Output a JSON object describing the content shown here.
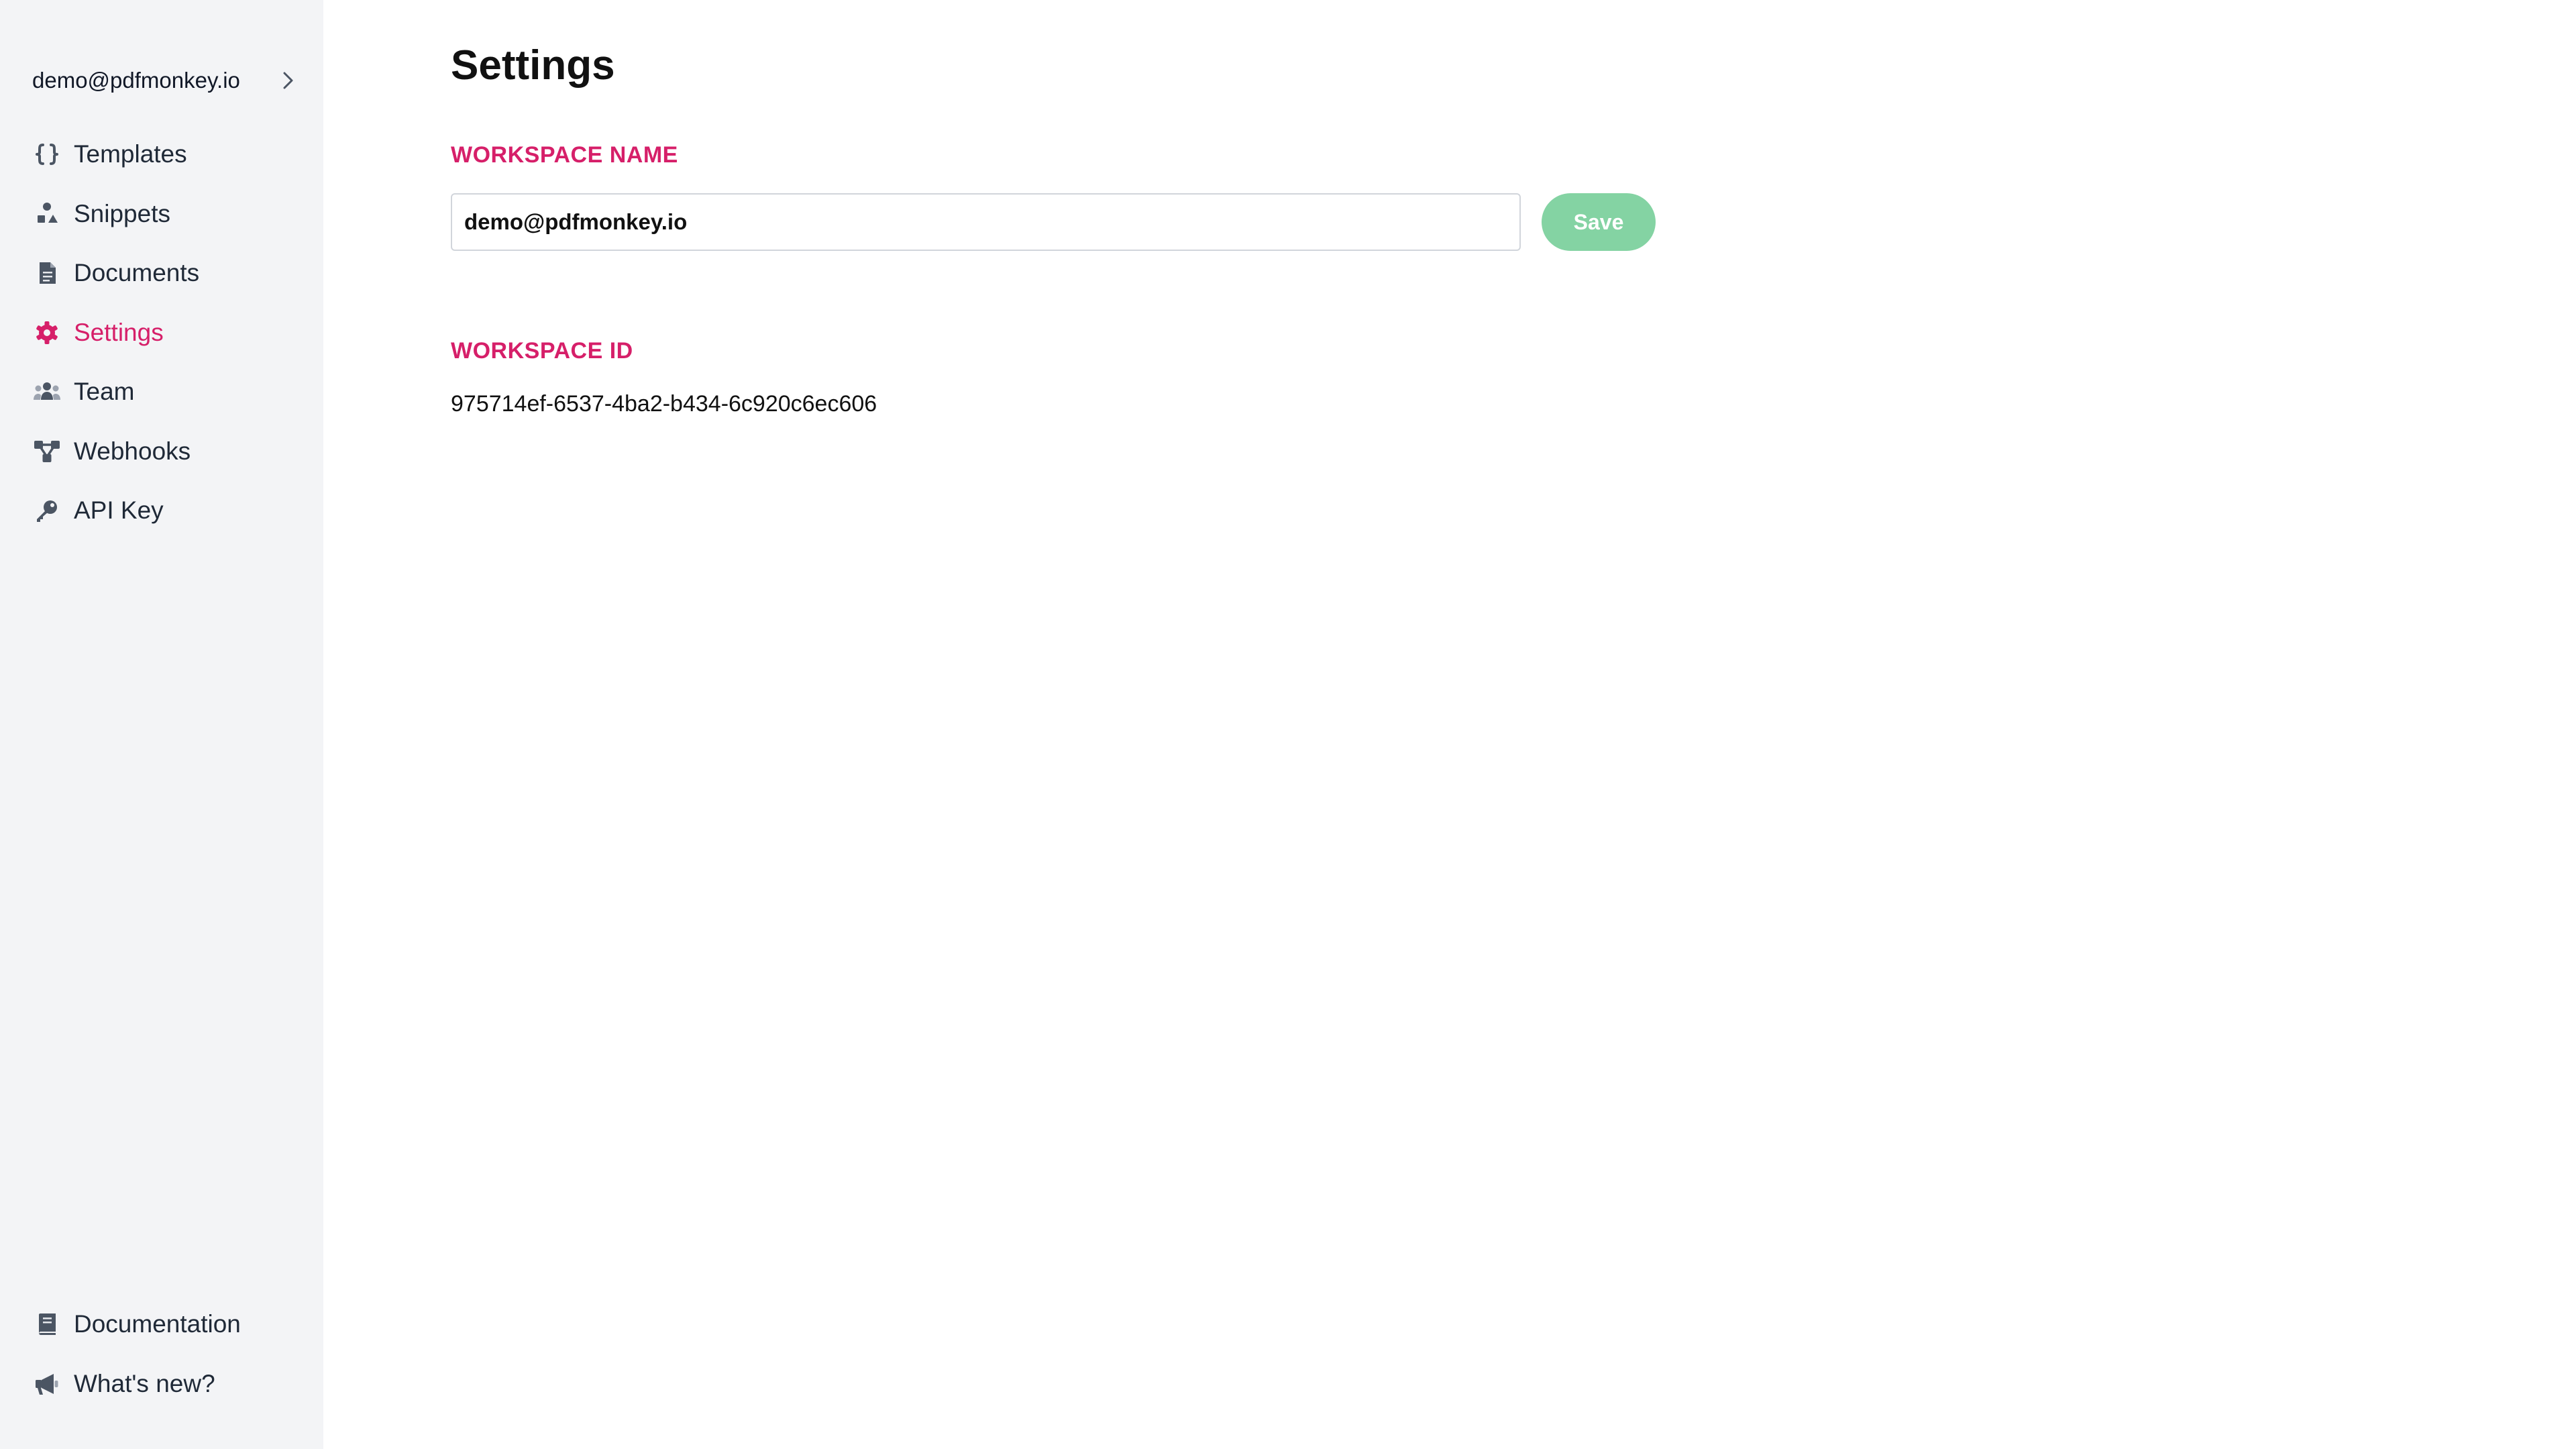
{
  "sidebar": {
    "workspace": {
      "name": "demo@pdfmonkey.io",
      "expand_icon": "chevron-right-icon"
    },
    "items": [
      {
        "label": "Templates",
        "icon": "braces-icon",
        "active": false
      },
      {
        "label": "Snippets",
        "icon": "shapes-icon",
        "active": false
      },
      {
        "label": "Documents",
        "icon": "file-icon",
        "active": false
      },
      {
        "label": "Settings",
        "icon": "gear-icon",
        "active": true
      },
      {
        "label": "Team",
        "icon": "users-icon",
        "active": false
      },
      {
        "label": "Webhooks",
        "icon": "webhook-icon",
        "active": false
      },
      {
        "label": "API Key",
        "icon": "key-icon",
        "active": false
      }
    ],
    "bottom_items": [
      {
        "label": "Documentation",
        "icon": "book-icon"
      },
      {
        "label": "What's new?",
        "icon": "megaphone-icon"
      }
    ]
  },
  "main": {
    "title": "Settings",
    "workspace_name_label": "WORKSPACE NAME",
    "workspace_name_value": "demo@pdfmonkey.io",
    "save_label": "Save",
    "workspace_id_label": "WORKSPACE ID",
    "workspace_id_value": "975714ef-6537-4ba2-b434-6c920c6ec606"
  },
  "colors": {
    "accent": "#d61f69",
    "sidebar_bg": "#f3f4f6",
    "icon": "#4b5563",
    "save_button": "#84d3a3"
  }
}
